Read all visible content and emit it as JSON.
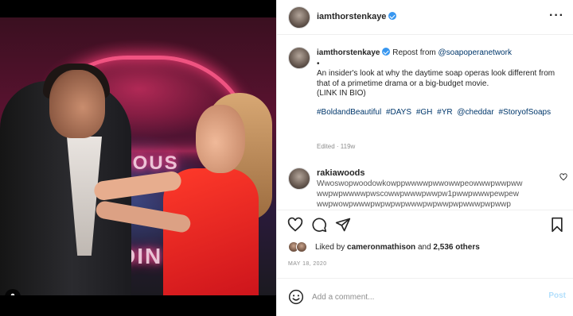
{
  "post": {
    "username": "iamthorstenkaye",
    "verified": true,
    "more_icon": "more-horizontal-icon"
  },
  "caption": {
    "username": "iamthorstenkaye",
    "repost_prefix": "Repost from",
    "repost_handle": "@soapoperanetwork",
    "separator": "•",
    "text": "An insider's look at why the daytime soap operas look different from that of a primetime drama or a big-budget movie.",
    "link_note": "(LINK IN BIO)",
    "hashtags": [
      "#BoldandBeautiful",
      "#DAYS",
      "#GH",
      "#YR",
      "@cheddar",
      "#StoryofSoaps"
    ],
    "edited": "Edited · 119w"
  },
  "comment": {
    "username": "rakiawoods",
    "text_line1": "Wwoswopwoodowkowppwwwwpwwowwpeowwwpwwpww",
    "text_line2": "wwpwpwwwwpwscowwpwwwpwwpw1pwwpwwwpewpew",
    "text_line3": "wwpwowpwwwpwpwpwpwwwpwpwwpwpwwwpwpwwp"
  },
  "actions": {
    "like_icon": "heart-icon",
    "comment_icon": "comment-bubble-icon",
    "share_icon": "paper-plane-icon",
    "save_icon": "bookmark-icon"
  },
  "likes": {
    "prefix": "Liked by",
    "user": "cameronmathison",
    "middle": "and",
    "count": "2,536 others"
  },
  "date": "MAY 18, 2020",
  "add_comment": {
    "placeholder": "Add a comment...",
    "post_label": "Post",
    "emoji_icon": "smiley-icon"
  },
  "media": {
    "sign_text_1": "FAMOUS",
    "sign_text_2": "DIN",
    "tag_icon": "user-tag-icon"
  },
  "colors": {
    "link": "#00376b",
    "verified": "#3897f0",
    "post_disabled": "#b2dffc",
    "muted": "#8e8e8e"
  }
}
